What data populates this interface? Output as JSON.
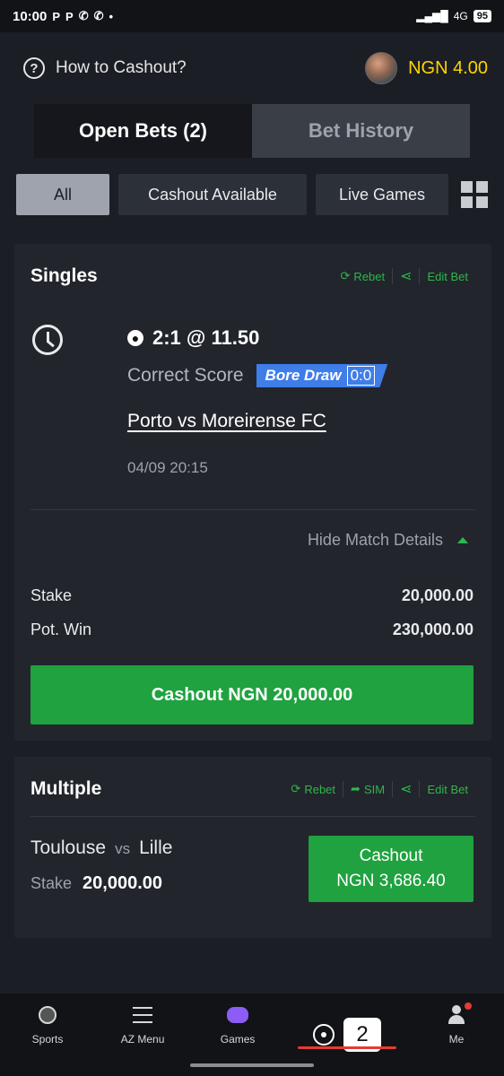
{
  "status_bar": {
    "time": "10:00",
    "icons": [
      "P",
      "P",
      "whatsapp-icon",
      "whatsapp-icon",
      "•"
    ],
    "network": "4G",
    "battery": "95"
  },
  "header": {
    "help_label": "How to Cashout?",
    "balance": "NGN 4.00"
  },
  "tabs": [
    {
      "label": "Open Bets (2)",
      "active": true
    },
    {
      "label": "Bet History",
      "active": false
    }
  ],
  "filters": [
    {
      "label": "All",
      "active": true
    },
    {
      "label": "Cashout Available",
      "active": false
    },
    {
      "label": "Live Games",
      "active": false
    }
  ],
  "singles": {
    "title": "Singles",
    "actions": {
      "rebet": "Rebet",
      "edit": "Edit Bet"
    },
    "selection": "2:1 @ 11.50",
    "market": "Correct Score",
    "tag": "Bore Draw",
    "tag_score": "0:0",
    "match": "Porto vs Moreirense FC",
    "kickoff": "04/09 20:15",
    "hide_details": "Hide Match Details",
    "stake_label": "Stake",
    "stake_value": "20,000.00",
    "potwin_label": "Pot. Win",
    "potwin_value": "230,000.00",
    "cashout": "Cashout NGN 20,000.00"
  },
  "multiple": {
    "title": "Multiple",
    "actions": {
      "rebet": "Rebet",
      "sim": "SIM",
      "edit": "Edit Bet"
    },
    "home": "Toulouse",
    "vs": "vs",
    "away": "Lille",
    "stake_label": "Stake",
    "stake_value": "20,000.00",
    "cashout_label": "Cashout",
    "cashout_value": "NGN 3,686.40"
  },
  "bottom_nav": {
    "sports": "Sports",
    "az_menu": "AZ Menu",
    "games": "Games",
    "betslip_count": "2",
    "me": "Me"
  }
}
